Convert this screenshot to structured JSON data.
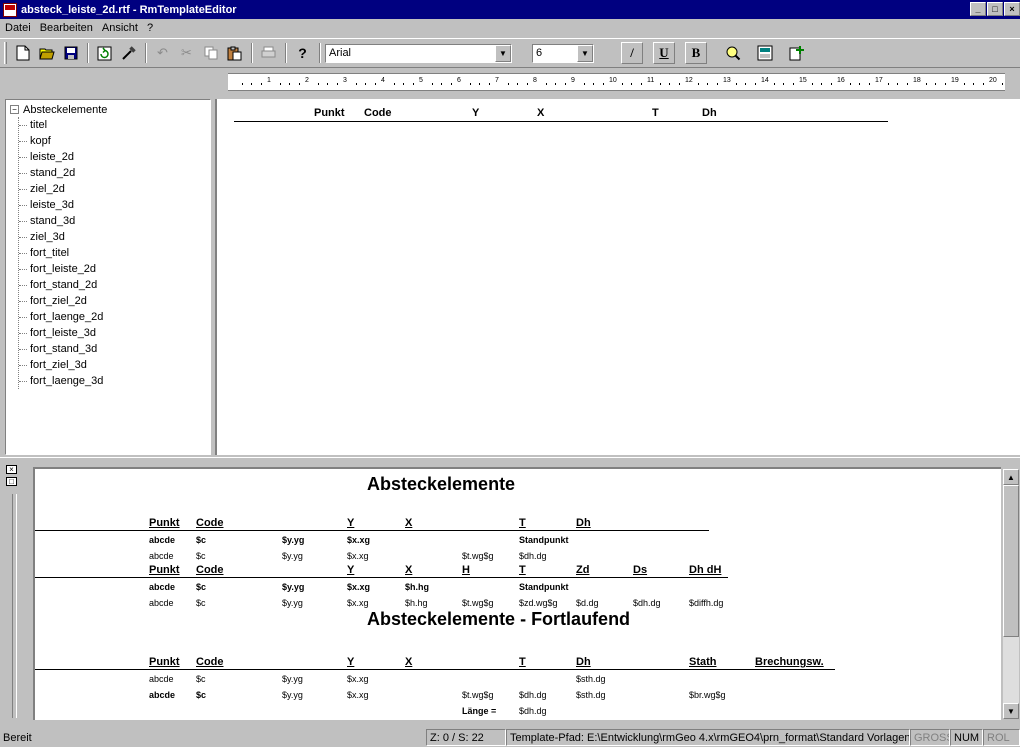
{
  "window": {
    "title": "absteck_leiste_2d.rtf - RmTemplateEditor",
    "controls": [
      "_",
      "□",
      "×"
    ]
  },
  "menu": [
    {
      "label": "Datei",
      "accel": "D"
    },
    {
      "label": "Bearbeiten",
      "accel": "B"
    },
    {
      "label": "Ansicht",
      "accel": "A"
    },
    {
      "label": "?",
      "accel": "?"
    }
  ],
  "toolbar": {
    "font_name": "Arial",
    "font_size": "6",
    "format_buttons": {
      "italic": "/",
      "underline": "U",
      "bold": "B"
    }
  },
  "ruler": {
    "numbers": [
      "1",
      "2",
      "3",
      "4",
      "5",
      "6",
      "7",
      "8",
      "9",
      "10",
      "11",
      "12",
      "13",
      "14",
      "15",
      "16",
      "17",
      "18",
      "19",
      "20"
    ]
  },
  "tree": {
    "root": "Absteckelemente",
    "expander": "−",
    "items": [
      "titel",
      "kopf",
      "leiste_2d",
      "stand_2d",
      "ziel_2d",
      "leiste_3d",
      "stand_3d",
      "ziel_3d",
      "fort_titel",
      "fort_leiste_2d",
      "fort_stand_2d",
      "fort_ziel_2d",
      "fort_laenge_2d",
      "fort_leiste_3d",
      "fort_stand_3d",
      "fort_ziel_3d",
      "fort_laenge_3d"
    ]
  },
  "editor": {
    "headers": {
      "punkt": "Punkt",
      "code": "Code",
      "y": "Y",
      "x": "X",
      "t": "T",
      "dh": "Dh"
    }
  },
  "preview": {
    "title": "Absteckelemente",
    "header1": {
      "punkt": "Punkt",
      "code": "Code",
      "y": "Y",
      "x": "X",
      "t": "T",
      "dh": "Dh"
    },
    "row1": {
      "punkt": "abcde",
      "code": "$c",
      "yy": "$y.yg",
      "xx": "$x.xg",
      "t": "Standpunkt"
    },
    "row2": {
      "punkt": "abcde",
      "code": "$c",
      "yy": "$y.yg",
      "xx": "$x.xg",
      "t": "$t.wg$g",
      "dh": "$dh.dg"
    },
    "header2": {
      "punkt": "Punkt",
      "code": "Code",
      "y": "Y",
      "x": "X",
      "h": "H",
      "t": "T",
      "zd": "Zd",
      "ds": "Ds",
      "dhdh": "Dh dH"
    },
    "row3": {
      "punkt": "abcde",
      "code": "$c",
      "yy": "$y.yg",
      "xx": "$x.xg",
      "hh": "$h.hg",
      "t": "Standpunkt"
    },
    "row4": {
      "punkt": "abcde",
      "code": "$c",
      "yy": "$y.yg",
      "xx": "$x.xg",
      "hh": "$h.hg",
      "t": "$t.wg$g",
      "zd": "$zd.wg$g",
      "ds": "$d.dg",
      "dh": "$dh.dg",
      "diff": "$diffh.dg"
    },
    "title2": "Absteckelemente - Fortlaufend",
    "header3": {
      "punkt": "Punkt",
      "code": "Code",
      "y": "Y",
      "x": "X",
      "t": "T",
      "dh": "Dh",
      "stath": "Stath",
      "brech": "Brechungsw."
    },
    "row5": {
      "punkt": "abcde",
      "code": "$c",
      "yy": "$y.yg",
      "xx": "$x.xg",
      "sth": "$sth.dg"
    },
    "row6": {
      "punkt": "abcde",
      "code": "$c",
      "yy": "$y.yg",
      "xx": "$x.xg",
      "t": "$t.wg$g",
      "dh": "$dh.dg",
      "sth": "$sth.dg",
      "br": "$br.wg$g"
    },
    "row7": {
      "laenge": "Länge =",
      "dh": "$dh.dg"
    }
  },
  "status": {
    "ready": "Bereit",
    "position": "Z:  0 / S:  22",
    "path": "Template-Pfad: E:\\Entwicklung\\rmGeo 4.x\\rmGEO4\\prn_format\\Standard Vorlagen\\",
    "caps": "GROSS",
    "num": "NUM",
    "scroll": "ROL"
  }
}
